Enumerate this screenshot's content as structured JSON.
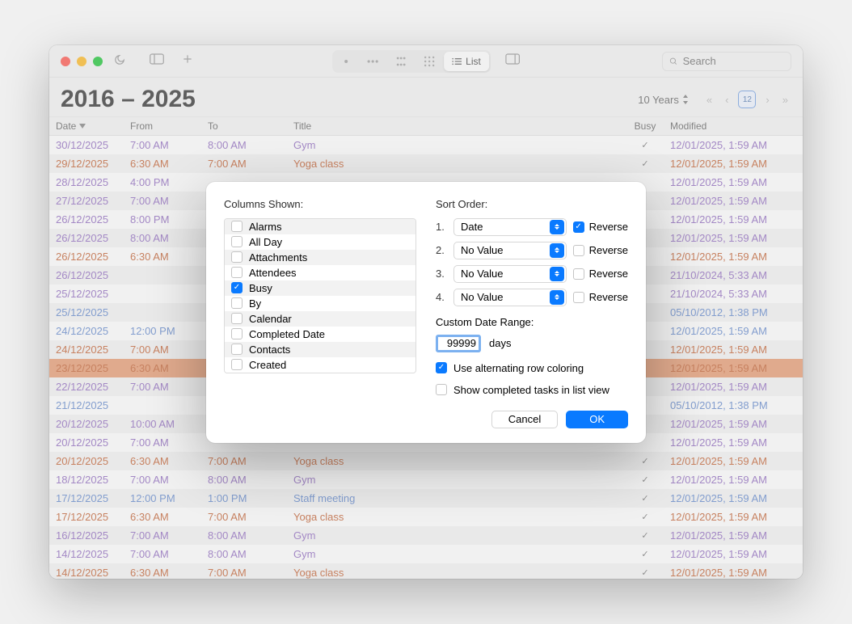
{
  "search": {
    "placeholder": "Search"
  },
  "header": {
    "title": "2016 – 2025",
    "range_label": "10 Years",
    "today_day": "12"
  },
  "columns": {
    "date": "Date",
    "from": "From",
    "to": "To",
    "title": "Title",
    "busy": "Busy",
    "modified": "Modified"
  },
  "view": {
    "list_label": "List"
  },
  "rows": [
    {
      "date": "30/12/2025",
      "from": "7:00 AM",
      "to": "8:00 AM",
      "title": "Gym",
      "busy": true,
      "mod": "12/01/2025, 1:59 AM",
      "cal": "purple",
      "selected": false
    },
    {
      "date": "29/12/2025",
      "from": "6:30 AM",
      "to": "7:00 AM",
      "title": "Yoga class",
      "busy": true,
      "mod": "12/01/2025, 1:59 AM",
      "cal": "orange",
      "selected": false
    },
    {
      "date": "28/12/2025",
      "from": "4:00 PM",
      "to": "",
      "title": "",
      "busy": false,
      "mod": "12/01/2025, 1:59 AM",
      "cal": "purple",
      "selected": false
    },
    {
      "date": "27/12/2025",
      "from": "7:00 AM",
      "to": "",
      "title": "",
      "busy": false,
      "mod": "12/01/2025, 1:59 AM",
      "cal": "purple",
      "selected": false
    },
    {
      "date": "26/12/2025",
      "from": "8:00 PM",
      "to": "",
      "title": "",
      "busy": false,
      "mod": "12/01/2025, 1:59 AM",
      "cal": "purple",
      "selected": false
    },
    {
      "date": "26/12/2025",
      "from": "8:00 AM",
      "to": "",
      "title": "",
      "busy": false,
      "mod": "12/01/2025, 1:59 AM",
      "cal": "purple",
      "selected": false
    },
    {
      "date": "26/12/2025",
      "from": "6:30 AM",
      "to": "",
      "title": "",
      "busy": false,
      "mod": "12/01/2025, 1:59 AM",
      "cal": "orange",
      "selected": false
    },
    {
      "date": "26/12/2025",
      "from": "",
      "to": "",
      "title": "",
      "busy": false,
      "mod": "21/10/2024, 5:33 AM",
      "cal": "purple",
      "selected": false
    },
    {
      "date": "25/12/2025",
      "from": "",
      "to": "",
      "title": "",
      "busy": false,
      "mod": "21/10/2024, 5:33 AM",
      "cal": "purple",
      "selected": false
    },
    {
      "date": "25/12/2025",
      "from": "",
      "to": "",
      "title": "",
      "busy": false,
      "mod": "05/10/2012, 1:38 PM",
      "cal": "blue",
      "selected": false
    },
    {
      "date": "24/12/2025",
      "from": "12:00 PM",
      "to": "",
      "title": "",
      "busy": false,
      "mod": "12/01/2025, 1:59 AM",
      "cal": "blue",
      "selected": false
    },
    {
      "date": "24/12/2025",
      "from": "7:00 AM",
      "to": "",
      "title": "",
      "busy": false,
      "mod": "12/01/2025, 1:59 AM",
      "cal": "orange",
      "selected": false
    },
    {
      "date": "23/12/2025",
      "from": "6:30 AM",
      "to": "",
      "title": "",
      "busy": false,
      "mod": "12/01/2025, 1:59 AM",
      "cal": "orange",
      "selected": true
    },
    {
      "date": "22/12/2025",
      "from": "7:00 AM",
      "to": "",
      "title": "",
      "busy": false,
      "mod": "12/01/2025, 1:59 AM",
      "cal": "purple",
      "selected": false
    },
    {
      "date": "21/12/2025",
      "from": "",
      "to": "",
      "title": "",
      "busy": false,
      "mod": "05/10/2012, 1:38 PM",
      "cal": "blue",
      "selected": false
    },
    {
      "date": "20/12/2025",
      "from": "10:00 AM",
      "to": "",
      "title": "",
      "busy": false,
      "mod": "12/01/2025, 1:59 AM",
      "cal": "purple",
      "selected": false
    },
    {
      "date": "20/12/2025",
      "from": "7:00 AM",
      "to": "",
      "title": "",
      "busy": false,
      "mod": "12/01/2025, 1:59 AM",
      "cal": "purple",
      "selected": false
    },
    {
      "date": "20/12/2025",
      "from": "6:30 AM",
      "to": "7:00 AM",
      "title": "Yoga class",
      "busy": true,
      "mod": "12/01/2025, 1:59 AM",
      "cal": "orange",
      "selected": false
    },
    {
      "date": "18/12/2025",
      "from": "7:00 AM",
      "to": "8:00 AM",
      "title": "Gym",
      "busy": true,
      "mod": "12/01/2025, 1:59 AM",
      "cal": "purple",
      "selected": false
    },
    {
      "date": "17/12/2025",
      "from": "12:00 PM",
      "to": "1:00 PM",
      "title": "Staff meeting",
      "busy": true,
      "mod": "12/01/2025, 1:59 AM",
      "cal": "blue",
      "selected": false
    },
    {
      "date": "17/12/2025",
      "from": "6:30 AM",
      "to": "7:00 AM",
      "title": "Yoga class",
      "busy": true,
      "mod": "12/01/2025, 1:59 AM",
      "cal": "orange",
      "selected": false
    },
    {
      "date": "16/12/2025",
      "from": "7:00 AM",
      "to": "8:00 AM",
      "title": "Gym",
      "busy": true,
      "mod": "12/01/2025, 1:59 AM",
      "cal": "purple",
      "selected": false
    },
    {
      "date": "14/12/2025",
      "from": "7:00 AM",
      "to": "8:00 AM",
      "title": "Gym",
      "busy": true,
      "mod": "12/01/2025, 1:59 AM",
      "cal": "purple",
      "selected": false
    },
    {
      "date": "14/12/2025",
      "from": "6:30 AM",
      "to": "7:00 AM",
      "title": "Yoga class",
      "busy": true,
      "mod": "12/01/2025, 1:59 AM",
      "cal": "orange",
      "selected": false
    }
  ],
  "dialog": {
    "columns_label": "Columns Shown:",
    "sort_label": "Sort Order:",
    "columns": [
      {
        "label": "Alarms",
        "checked": false
      },
      {
        "label": "All Day",
        "checked": false
      },
      {
        "label": "Attachments",
        "checked": false
      },
      {
        "label": "Attendees",
        "checked": false
      },
      {
        "label": "Busy",
        "checked": true
      },
      {
        "label": "By",
        "checked": false
      },
      {
        "label": "Calendar",
        "checked": false
      },
      {
        "label": "Completed Date",
        "checked": false
      },
      {
        "label": "Contacts",
        "checked": false
      },
      {
        "label": "Created",
        "checked": false
      }
    ],
    "sorts": [
      {
        "num": "1.",
        "value": "Date",
        "reverse": true
      },
      {
        "num": "2.",
        "value": "No Value",
        "reverse": false
      },
      {
        "num": "3.",
        "value": "No Value",
        "reverse": false
      },
      {
        "num": "4.",
        "value": "No Value",
        "reverse": false
      }
    ],
    "reverse_label": "Reverse",
    "custom_range_label": "Custom Date Range:",
    "days_value": "99999",
    "days_label": "days",
    "alt_rows": {
      "label": "Use alternating row coloring",
      "checked": true
    },
    "show_completed": {
      "label": "Show completed tasks in list view",
      "checked": false
    },
    "cancel": "Cancel",
    "ok": "OK"
  }
}
